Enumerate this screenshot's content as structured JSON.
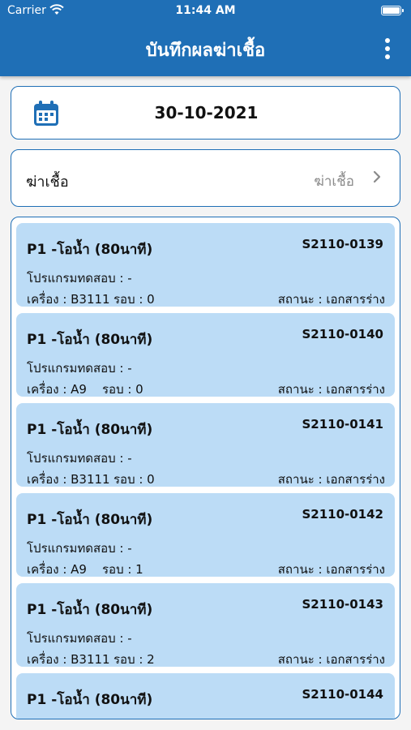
{
  "status_bar": {
    "carrier": "Carrier",
    "time": "11:44 AM"
  },
  "header": {
    "title": "บันทึกผลฆ่าเชื้อ"
  },
  "date_picker": {
    "value": "30-10-2021"
  },
  "filter": {
    "label": "ฆ่าเชื้อ",
    "value": "ฆ่าเชื้อ"
  },
  "items": [
    {
      "name": "P1 -โอน้ำ (80นาที)",
      "code": "S2110-0139",
      "program": "โปรแกรมทดสอบ : -",
      "machine": "เครื่อง : B3111",
      "round": "รอบ : 0",
      "status": "สถานะ : เอกสารร่าง"
    },
    {
      "name": "P1 -โอน้ำ (80นาที)",
      "code": "S2110-0140",
      "program": "โปรแกรมทดสอบ : -",
      "machine": "เครื่อง : A9",
      "round": "รอบ : 0",
      "status": "สถานะ : เอกสารร่าง"
    },
    {
      "name": "P1 -โอน้ำ (80นาที)",
      "code": "S2110-0141",
      "program": "โปรแกรมทดสอบ : -",
      "machine": "เครื่อง : B3111",
      "round": "รอบ : 0",
      "status": "สถานะ : เอกสารร่าง"
    },
    {
      "name": "P1 -โอน้ำ (80นาที)",
      "code": "S2110-0142",
      "program": "โปรแกรมทดสอบ : -",
      "machine": "เครื่อง : A9",
      "round": "รอบ : 1",
      "status": "สถานะ : เอกสารร่าง"
    },
    {
      "name": "P1 -โอน้ำ (80นาที)",
      "code": "S2110-0143",
      "program": "โปรแกรมทดสอบ : -",
      "machine": "เครื่อง : B3111",
      "round": "รอบ : 2",
      "status": "สถานะ : เอกสารร่าง"
    },
    {
      "name": "P1 -โอน้ำ (80นาที)",
      "code": "S2110-0144",
      "program": "",
      "machine": "",
      "round": "",
      "status": ""
    }
  ],
  "colors": {
    "primary": "#1f6fb6",
    "item_bg": "#bcdcf6"
  }
}
